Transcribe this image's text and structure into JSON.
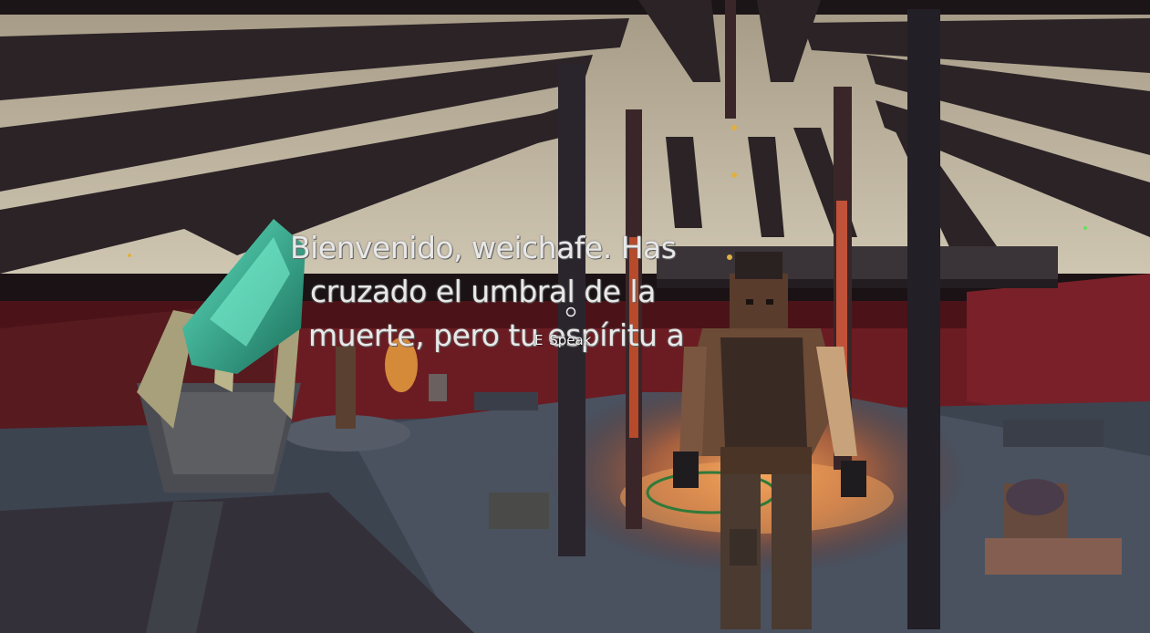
{
  "hud": {
    "dialogue_line_1": "Bienvenido, weichafe. Has",
    "dialogue_line_2": "cruzado el umbral de la",
    "dialogue_line_3": "muerte, pero tu espíritu a",
    "interact_key": "E",
    "interact_label": "Speak",
    "crosshair_icon": "circle-crosshair-icon"
  },
  "colors": {
    "tent_canvas": "#bdb29b",
    "tent_beams": "#2b2326",
    "wall_red": "#6b1c22",
    "floor": "#3c4450",
    "fire_glow": "#f08a3a",
    "torch_crystal": "#2fae8f"
  }
}
